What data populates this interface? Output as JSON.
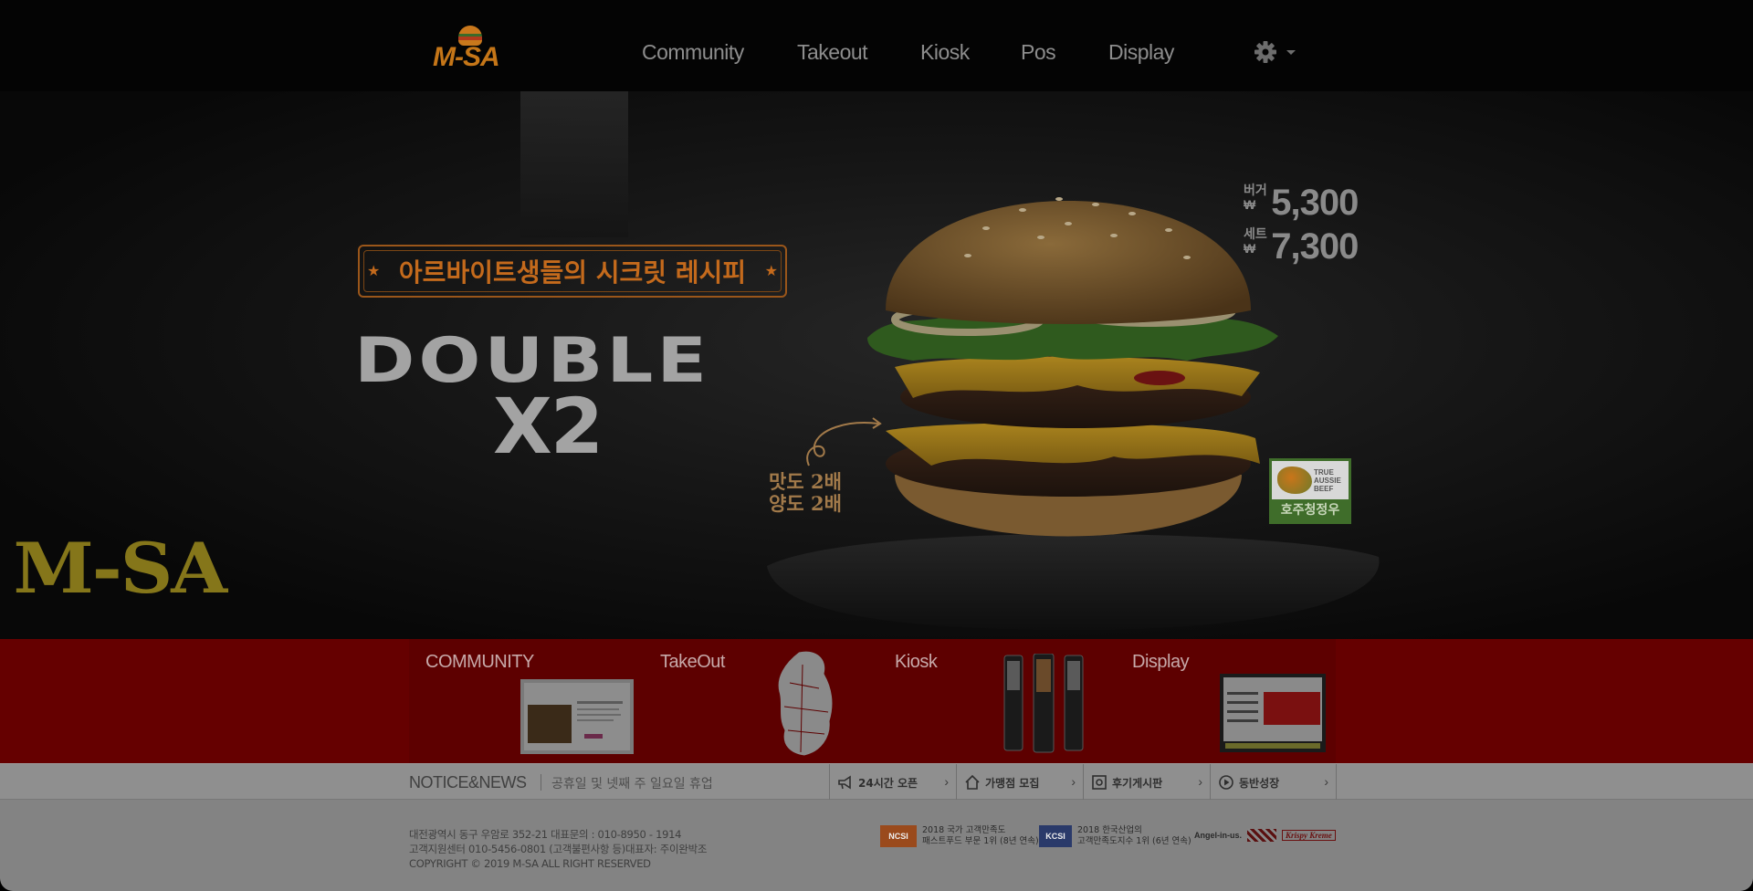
{
  "nav": {
    "logo_text": "M-SA",
    "links": [
      "Community",
      "Takeout",
      "Kiosk",
      "Pos",
      "Display"
    ],
    "settings_icon": "gear-icon",
    "dropdown_icon": "caret-down-icon"
  },
  "hero": {
    "ribbon_text": "아르바이트생들의 시크릿 레시피",
    "headline": "DOUBLE",
    "subheadline": "X2",
    "tagline_line1": "맛도 2배",
    "tagline_line2": "양도 2배",
    "prices": [
      {
        "label": "버거",
        "currency": "₩",
        "amount": "5,300"
      },
      {
        "label": "세트",
        "currency": "₩",
        "amount": "7,300"
      }
    ],
    "beef_badge_top": "TRUE AUSSIE BEEF",
    "beef_badge_bottom": "호주청정우",
    "brand_watermark": "M-SA"
  },
  "services": [
    {
      "title": "COMMUNITY"
    },
    {
      "title": "TakeOut"
    },
    {
      "title": "Kiosk"
    },
    {
      "title": "Display"
    }
  ],
  "notice": {
    "heading": "NOTICE&NEWS",
    "message": "공휴일 및 넷째 주 일요일 휴업",
    "quick_links": [
      {
        "label": "24시간 오픈",
        "icon": "megaphone-icon"
      },
      {
        "label": "가맹점 모집",
        "icon": "house-icon"
      },
      {
        "label": "후기게시판",
        "icon": "photo-icon"
      },
      {
        "label": "동반성장",
        "icon": "play-circle-icon"
      }
    ]
  },
  "footer": {
    "address": "대전광역시 동구 우암로 352-21 대표문의 : 010-8950 - 1914",
    "support": "고객지원센터 010-5456-0801 (고객불편사항 등)대표자: 주이완박조",
    "copyright": "COPYRIGHT © 2019 M-SA ALL RIGHT RESERVED",
    "awards": [
      {
        "badge": "NCSI",
        "line1": "2018 국가 고객만족도",
        "line2": "패스트푸드 부문 1위 (8년 연속)",
        "color": "#9a4a1c"
      },
      {
        "badge": "KCSI",
        "line1": "2018 한국산업의",
        "line2": "고객만족도지수 1위 (6년 연속)",
        "color": "#2a3a6a"
      }
    ],
    "partners": [
      "Angel-in-us.",
      "Krispy Kreme"
    ]
  },
  "colors": {
    "nav_bg": "#040404",
    "accent_orange": "#c57618",
    "red_band": "#650000",
    "notice_bar": "#8f8f8f",
    "footer_bg": "#838383"
  }
}
